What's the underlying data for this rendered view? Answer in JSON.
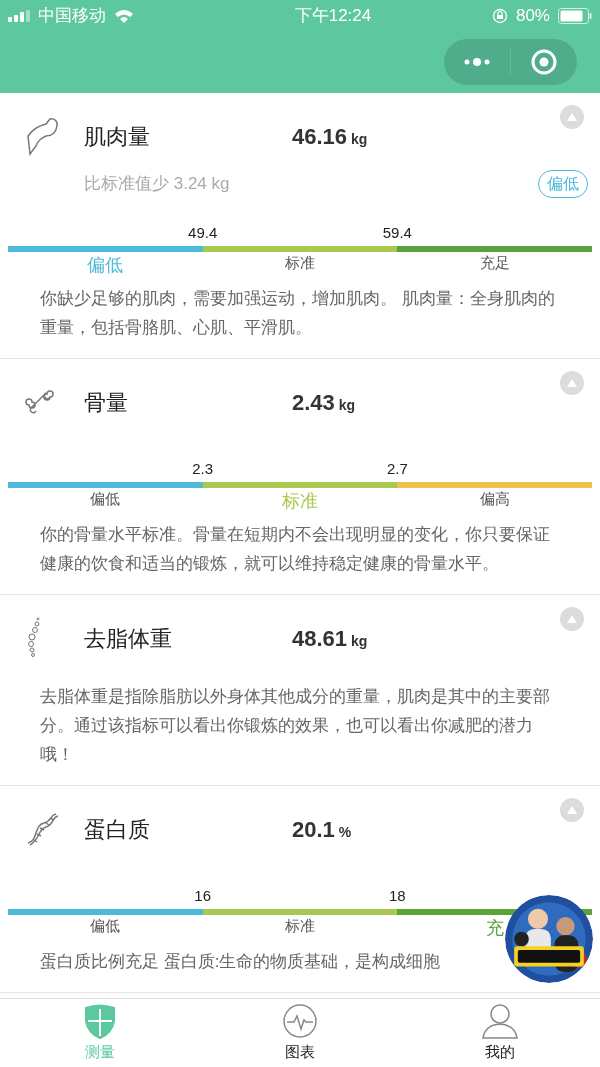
{
  "status_bar": {
    "carrier": "中国移动",
    "time": "下午12:24",
    "battery": "80%"
  },
  "metrics": [
    {
      "kind": "arm",
      "title": "肌肉量",
      "value": "46.16",
      "unit": "kg",
      "expanded": true,
      "note": "比标准值少 3.24 kg",
      "badge": "偏低",
      "scale": {
        "thresholds": [
          "49.4",
          "59.4"
        ],
        "segments": [
          {
            "label": "偏低",
            "color": "#4fb9dc",
            "selected": true
          },
          {
            "label": "标准",
            "color": "#a8c850",
            "selected": false
          },
          {
            "label": "充足",
            "color": "#58a33c",
            "selected": false
          }
        ]
      },
      "description": "你缺少足够的肌肉，需要加强运动，增加肌肉。 肌肉量：全身肌肉的重量，包括骨胳肌、心肌、平滑肌。"
    },
    {
      "kind": "bone",
      "title": "骨量",
      "value": "2.43",
      "unit": "kg",
      "expanded": true,
      "scale": {
        "thresholds": [
          "2.3",
          "2.7"
        ],
        "segments": [
          {
            "label": "偏低",
            "color": "#4fb9dc",
            "selected": false
          },
          {
            "label": "标准",
            "color": "#a8c850",
            "selected": true
          },
          {
            "label": "偏高",
            "color": "#efc14f",
            "selected": false
          }
        ]
      },
      "description": "你的骨量水平标准。骨量在短期内不会出现明显的变化，你只要保证健康的饮食和适当的锻炼，就可以维持稳定健康的骨量水平。"
    },
    {
      "kind": "spine",
      "title": "去脂体重",
      "value": "48.61",
      "unit": "kg",
      "expanded": true,
      "description": "去脂体重是指除脂肪以外身体其他成分的重量，肌肉是其中的主要部分。通过该指标可以看出你锻炼的效果，也可以看出你减肥的潜力哦！"
    },
    {
      "kind": "dna",
      "title": "蛋白质",
      "value": "20.1",
      "unit": "%",
      "expanded": true,
      "scale": {
        "thresholds": [
          "16",
          "18"
        ],
        "segments": [
          {
            "label": "偏低",
            "color": "#4fb9dc",
            "selected": false
          },
          {
            "label": "标准",
            "color": "#a8c850",
            "selected": false
          },
          {
            "label": "充",
            "color": "#58a33c",
            "selected": true
          }
        ]
      },
      "description": "蛋白质比例充足 蛋白质:生命的物质基础，是构成细胞"
    }
  ],
  "tabs": [
    {
      "kind": "shield",
      "label": "测量",
      "selected": true
    },
    {
      "kind": "pulse",
      "label": "图表",
      "selected": false
    },
    {
      "kind": "person",
      "label": "我的",
      "selected": false
    }
  ]
}
